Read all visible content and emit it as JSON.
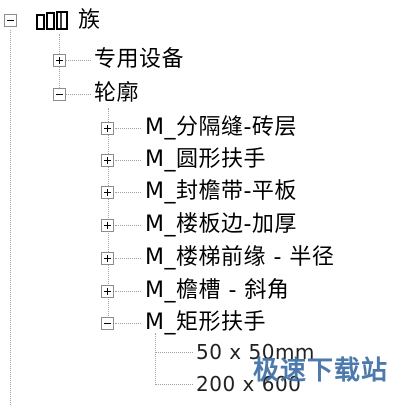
{
  "tree": {
    "root": {
      "label": "族",
      "expanded": true,
      "icon": "family-folder-icon"
    },
    "nodes": [
      {
        "label": "专用设备",
        "expanded": false
      },
      {
        "label": "轮廓",
        "expanded": true
      }
    ],
    "profile_children": [
      {
        "label": "M_分隔缝-砖层",
        "expanded": false
      },
      {
        "label": "M_圆形扶手",
        "expanded": false
      },
      {
        "label": "M_封檐带-平板",
        "expanded": false
      },
      {
        "label": "M_楼板边-加厚",
        "expanded": false
      },
      {
        "label": "M_楼梯前缘 - 半径",
        "expanded": false
      },
      {
        "label": "M_檐槽 - 斜角",
        "expanded": false
      },
      {
        "label": "M_矩形扶手",
        "expanded": true
      }
    ],
    "rect_rail_types": [
      {
        "label": "50 x 50mm"
      },
      {
        "label": "200 x 600"
      }
    ]
  },
  "watermark": {
    "text": "极速下载站",
    "color": "#3d6fa5"
  }
}
